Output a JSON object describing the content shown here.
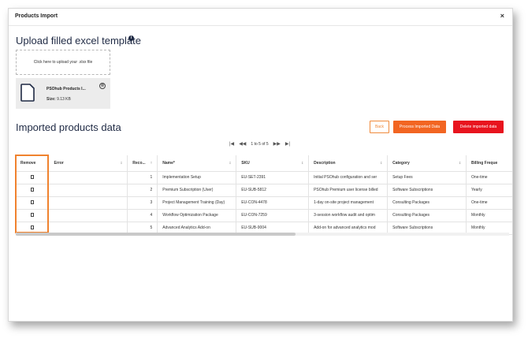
{
  "modal": {
    "title": "Products Import",
    "close_icon": "close-icon",
    "close_label": "×"
  },
  "upload": {
    "title": "Upload filled excel template",
    "info_icon": "i",
    "dropzone_text": "Click here to upload your .xlsx file",
    "file": {
      "name": "PSOhub Products I...",
      "size_label": "Size:",
      "size_value": "9.13 KB",
      "remove_icon": "⊗"
    }
  },
  "imported": {
    "title": "Imported products data",
    "buttons": {
      "back": "Back",
      "process": "Process Imported Data",
      "delete": "Delete imported data"
    },
    "pager": {
      "first": "|◀",
      "prev": "◀◀",
      "text": "1 to 5 of 5",
      "next": "▶▶",
      "last": "▶|"
    }
  },
  "table": {
    "columns": [
      {
        "label": "Remove",
        "sort": ""
      },
      {
        "label": "Error",
        "sort": "↕"
      },
      {
        "label": "Reco...",
        "sort": "↑"
      },
      {
        "label": "Name*",
        "sort": "↕"
      },
      {
        "label": "SKU",
        "sort": "↕"
      },
      {
        "label": "Description",
        "sort": "↕"
      },
      {
        "label": "Category",
        "sort": "↕"
      },
      {
        "label": "Billing Freque",
        "sort": ""
      }
    ],
    "rows": [
      {
        "error": "",
        "record": "1",
        "name": "Implementation Setup",
        "sku": "EU-SET-2391",
        "description": "Initial PSOhub configuration and ser",
        "category": "Setup Fees",
        "billing": "One-time"
      },
      {
        "error": "",
        "record": "2",
        "name": "Premium Subscription (User)",
        "sku": "EU-SUB-5812",
        "description": "PSOhub Premium user license billed",
        "category": "Software Subscriptions",
        "billing": "Yearly"
      },
      {
        "error": "",
        "record": "3",
        "name": "Project Management Training (Day)",
        "sku": "EU-CON-4478",
        "description": "1-day on-site project management",
        "category": "Consulting Packages",
        "billing": "One-time"
      },
      {
        "error": "",
        "record": "4",
        "name": "Workflow Optimization Package",
        "sku": "EU-CON-7259",
        "description": "3-session workflow audit and optim",
        "category": "Consulting Packages",
        "billing": "Monthly"
      },
      {
        "error": "",
        "record": "5",
        "name": "Advanced Analytics Add-on",
        "sku": "EU-SUB-9004",
        "description": "Add-on for advanced analytics mod",
        "category": "Software Subscriptions",
        "billing": "Monthly"
      }
    ]
  },
  "colors": {
    "accent_orange": "#f26522",
    "danger_red": "#e8141e",
    "title_navy": "#1f2a44"
  }
}
